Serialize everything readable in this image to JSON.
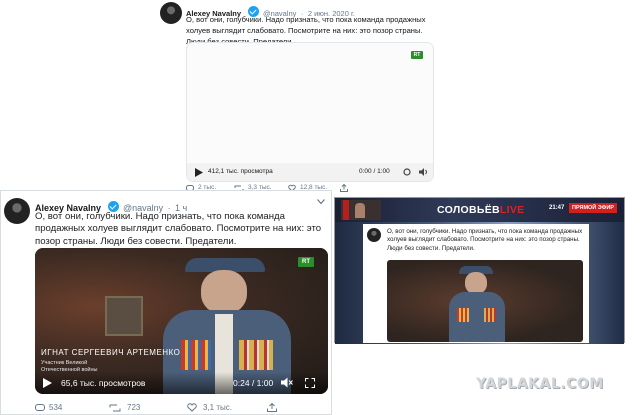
{
  "tweet_top": {
    "author_name": "Alexey Navalny",
    "handle": "@navalny",
    "separator": "·",
    "date": "2 июн. 2020 г.",
    "text": "О, вот они, голубчики. Надо признать, что пока команда продажных холуев выглядит слабовато. Посмотрите на них: это позор страны. Люди без совести. Предатели.",
    "video_badge": "RT",
    "views": "412,1 тыс. просмотра",
    "time": "0:00 / 1:00",
    "actions": {
      "replies": "2 тыс.",
      "retweets": "3,3 тыс.",
      "likes": "12,8 тыс."
    }
  },
  "tweet_bottom": {
    "author_name": "Alexey Navalny",
    "handle": "@navalny",
    "separator": "·",
    "age": "1 ч",
    "text": "О, вот они, голубчики. Надо признать, что пока команда продажных холуев выглядит слабовато. Посмотрите на них: это позор страны. Люди без совести. Предатели.",
    "video_badge": "RT",
    "caption_name": "ИГНАТ СЕРГЕЕВИЧ АРТЕМЕНКО",
    "caption_line1": "Участник Великой",
    "caption_line2": "Отечественной войны",
    "views": "65,6 тыс. просмотров",
    "time": "0:24 / 1:00",
    "actions": {
      "replies": "534",
      "retweets": "723",
      "likes": "3,1 тыс."
    }
  },
  "tv_screenshot": {
    "show_title": "СОЛОВЬЁВ",
    "show_title_live": "LIVE",
    "clock": "21:47",
    "live_label": "ПРЯМОЙ ЭФИР",
    "text": "О, вот они, голубчики. Надо признать, что пока команда продажных холуев выглядит слабовато. Посмотрите на них: это позор страны. Люди без совести. Предатели."
  },
  "watermark": "YAPLAKAL.COM",
  "colors": {
    "verified": "#1da1f2",
    "rt_green": "#2a8f2a",
    "muted": "#657786",
    "live_red": "#e02020",
    "tv_white": "#ffffff"
  }
}
